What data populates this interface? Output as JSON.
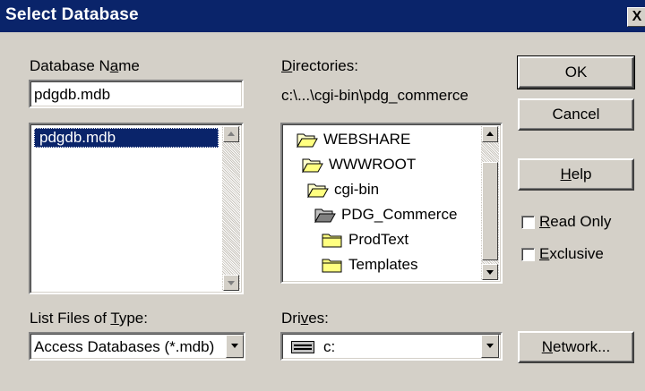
{
  "window": {
    "title": "Select Database",
    "close_symbol": "X"
  },
  "database_name": {
    "label": "Database Name",
    "label_underline_char": "a",
    "value": "pdgdb.mdb",
    "files": [
      "pdgdb.mdb"
    ],
    "selected_index": 0
  },
  "directories": {
    "label": "Directories:",
    "current_path": "c:\\...\\cgi-bin\\pdg_commerce",
    "items": [
      {
        "name": "WEBSHARE",
        "icon": "open-folder-icon"
      },
      {
        "name": "WWWROOT",
        "icon": "open-folder-icon"
      },
      {
        "name": "cgi-bin",
        "icon": "open-folder-icon"
      },
      {
        "name": "PDG_Commerce",
        "icon": "open-folder-selected-icon"
      },
      {
        "name": "ProdText",
        "icon": "closed-folder-icon"
      },
      {
        "name": "Templates",
        "icon": "closed-folder-icon"
      }
    ]
  },
  "file_type": {
    "label": "List Files of Type:",
    "selected": "Access Databases (*.mdb)"
  },
  "drives": {
    "label": "Drives:",
    "selected": "c:",
    "icon": "drive-icon"
  },
  "buttons": {
    "ok": "OK",
    "cancel": "Cancel",
    "help": "Help",
    "network": "Network..."
  },
  "options": {
    "read_only": {
      "label": "Read Only",
      "checked": false
    },
    "exclusive": {
      "label": "Exclusive",
      "checked": false
    }
  }
}
